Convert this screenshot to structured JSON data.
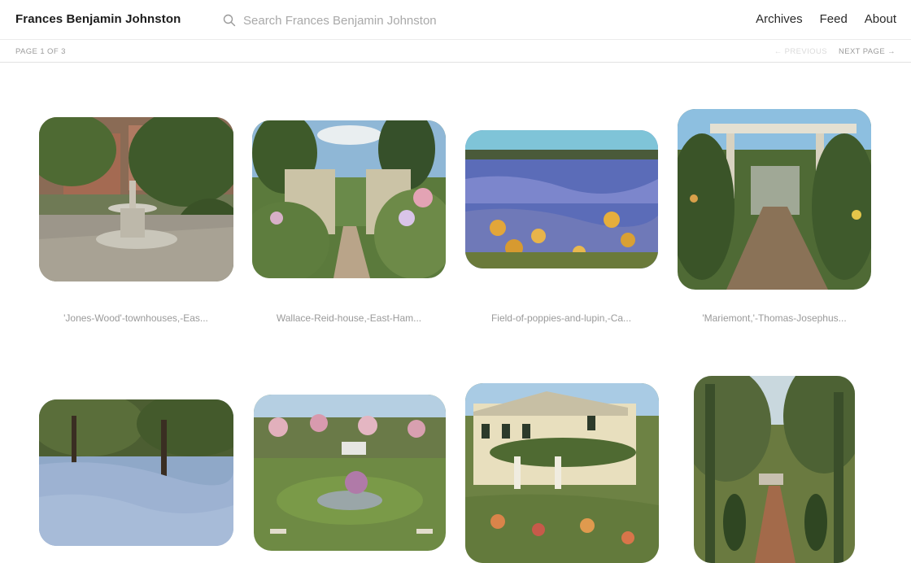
{
  "header": {
    "site_title": "Frances Benjamin Johnston",
    "search_placeholder": "Search Frances Benjamin Johnston",
    "nav": [
      "Archives",
      "Feed",
      "About"
    ]
  },
  "pager": {
    "page_count": "PAGE 1 OF 3",
    "previous": "← PREVIOUS",
    "next": "NEXT PAGE →"
  },
  "photos": [
    {
      "caption": "'Jones-Wood'-townhouses,-Eas...",
      "scene": "courtyard-fountain"
    },
    {
      "caption": "Wallace-Reid-house,-East-Ham...",
      "scene": "garden-gateway"
    },
    {
      "caption": "Field-of-poppies-and-lupin,-Ca...",
      "scene": "flower-field"
    },
    {
      "caption": "'Mariemont,'-Thomas-Josephus...",
      "scene": "pergola-walk"
    },
    {
      "caption": "",
      "scene": "bluebell-woods"
    },
    {
      "caption": "",
      "scene": "rose-arbor-pool"
    },
    {
      "caption": "",
      "scene": "house-garden"
    },
    {
      "caption": "",
      "scene": "cypress-path"
    }
  ]
}
